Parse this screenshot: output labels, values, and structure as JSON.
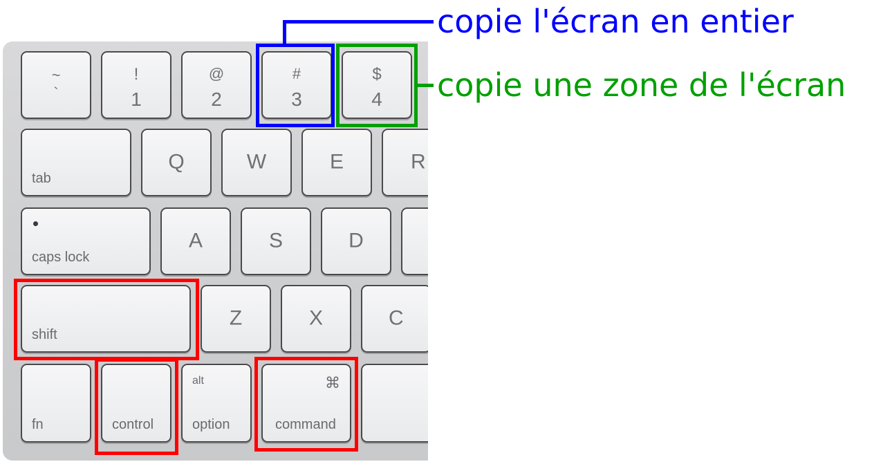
{
  "colors": {
    "full_screen": "#0000ff",
    "zone": "#00a000",
    "modifier": "#ff0000"
  },
  "annotations": {
    "full_screen": "copie l'écran en entier",
    "zone": "copie une zone de l'écran"
  },
  "keys": {
    "tilde": {
      "top": "~",
      "bottom": "`"
    },
    "one": {
      "top": "!",
      "bottom": "1"
    },
    "two": {
      "top": "@",
      "bottom": "2"
    },
    "three": {
      "top": "#",
      "bottom": "3"
    },
    "four": {
      "top": "$",
      "bottom": "4"
    },
    "tab": "tab",
    "q": "Q",
    "w": "W",
    "e": "E",
    "r": "R",
    "caps_lock": "caps lock",
    "a": "A",
    "s": "S",
    "d": "D",
    "shift": "shift",
    "z": "Z",
    "x": "X",
    "c": "C",
    "fn": "fn",
    "control": "control",
    "option": {
      "top": "alt",
      "bottom": "option"
    },
    "command": {
      "symbol": "⌘",
      "label": "command"
    }
  }
}
